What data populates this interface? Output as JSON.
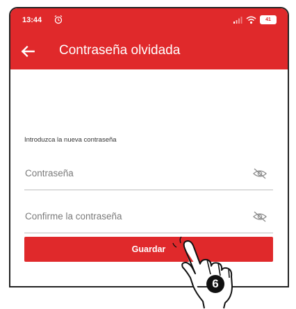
{
  "status_bar": {
    "time": "13:44",
    "alarm_icon": "alarm-icon",
    "icons": [
      "signal-icon",
      "wifi-icon",
      "battery-icon"
    ],
    "battery_level": "41"
  },
  "app_bar": {
    "back_icon": "arrow-left-icon",
    "title": "Contraseña olvidada"
  },
  "form": {
    "label": "Introduzca la nueva contraseña",
    "password_placeholder": "Contraseña",
    "confirm_placeholder": "Confirme la contraseña",
    "visibility_icon": "eye-off-icon",
    "save_label": "Guardar"
  },
  "annotation": {
    "step": "6",
    "pointer_icon": "pointing-hand-icon"
  },
  "colors": {
    "brand": "#e0292b",
    "badge": "#111111"
  }
}
